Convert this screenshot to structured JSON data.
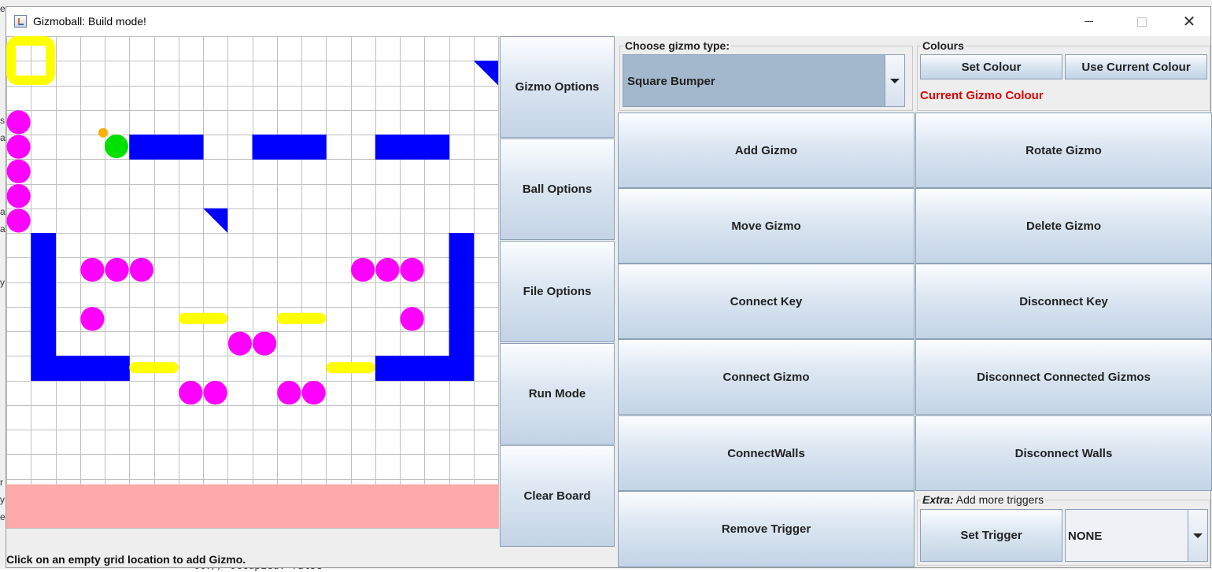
{
  "window": {
    "title": "Gizmoball: Build mode!"
  },
  "background": {
    "edge_chars": [
      "e",
      "s",
      "a",
      "a",
      "a",
      "y",
      "r",
      "y",
      "e"
    ],
    "bottom_text": "ll.// occupied: false"
  },
  "status": {
    "text": "Click on an empty grid location to add Gizmo."
  },
  "nav": {
    "gizmo_options": "Gizmo Options",
    "ball_options": "Ball Options",
    "file_options": "File Options",
    "run_mode": "Run Mode",
    "clear_board": "Clear Board"
  },
  "gizmo_type": {
    "legend": "Choose gizmo type:",
    "selected": "Square Bumper"
  },
  "colours": {
    "legend": "Colours",
    "set_colour": "Set Colour",
    "use_current": "Use Current Colour",
    "current_label": "Current Gizmo Colour",
    "current_color": "#e00000"
  },
  "actions": {
    "add_gizmo": "Add Gizmo",
    "rotate_gizmo": "Rotate Gizmo",
    "move_gizmo": "Move Gizmo",
    "delete_gizmo": "Delete Gizmo",
    "connect_key": "Connect Key",
    "disconnect_key": "Disconnect Key",
    "connect_gizmo": "Connect Gizmo",
    "disconnect_connected": "Disconnect Connected Gizmos",
    "connect_walls": "ConnectWalls",
    "disconnect_walls": "Disconnect Walls",
    "remove_trigger": "Remove Trigger"
  },
  "extra": {
    "legend_em": "Extra:",
    "legend_rest": " Add more triggers",
    "set_trigger": "Set Trigger",
    "trigger_selected": "NONE"
  },
  "board_colors": {
    "grid": "#c0c0c0",
    "absorber": "#ffaaaa",
    "square": "#0000ff",
    "circle": "#ff00ff",
    "flipper": "#ffff00",
    "ball": "#00e000",
    "ball_marker": "#ffb000",
    "triangle": "#0000ff",
    "selector": "#ffff00"
  }
}
